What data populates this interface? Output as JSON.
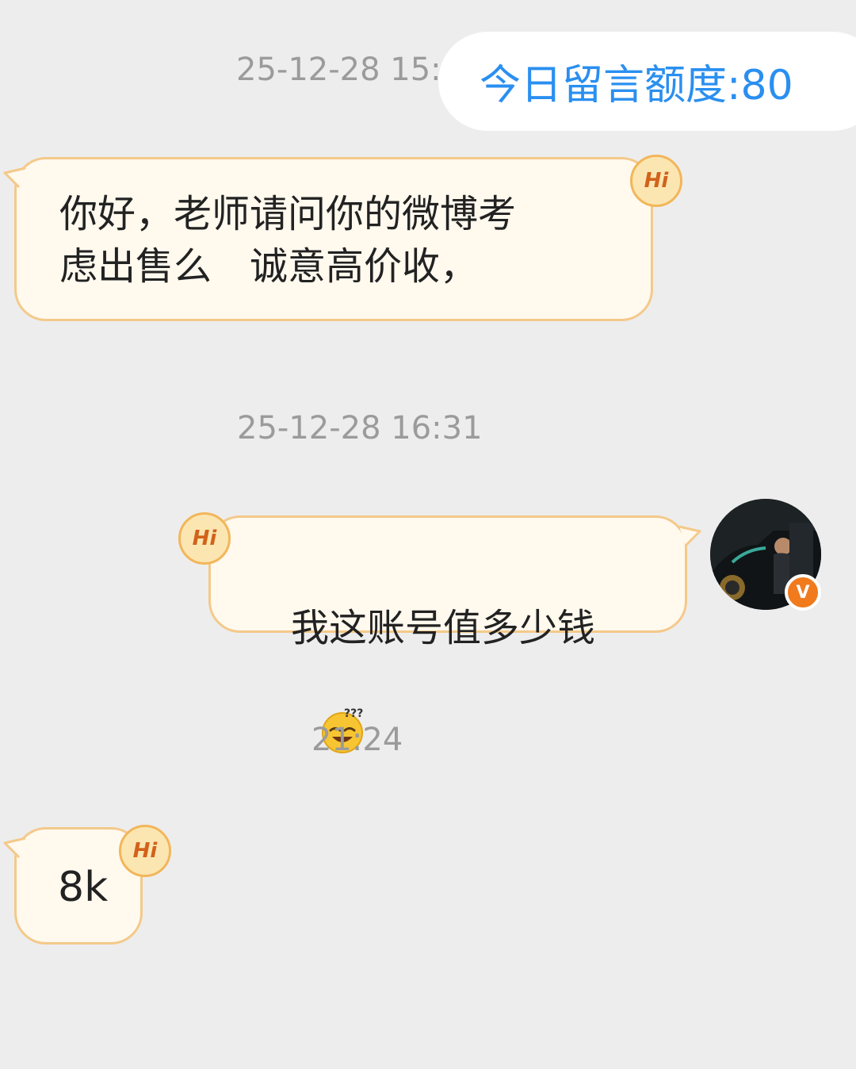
{
  "quota": {
    "label": "今日留言额度:80"
  },
  "messages": [
    {
      "time": "25-12-28 15:1",
      "text": "你好，老师请问你的微博考\n虑出售么　诚意高价收，",
      "side": "left"
    },
    {
      "time": "25-12-28 16:31",
      "text": "我这账号值多少钱",
      "side": "right",
      "emoji": "squinting-face-with-question-marks"
    },
    {
      "time": "21:24",
      "text": "8k",
      "side": "left"
    }
  ],
  "badges": {
    "hi": "Hi",
    "verified": "V"
  },
  "colors": {
    "background": "#ededed",
    "bubble_fill": "#fff9ee",
    "bubble_border": "#f4c98a",
    "quota_text": "#2a8ff0",
    "timestamp": "#9b9b9b",
    "verified_badge": "#f07a1c"
  }
}
